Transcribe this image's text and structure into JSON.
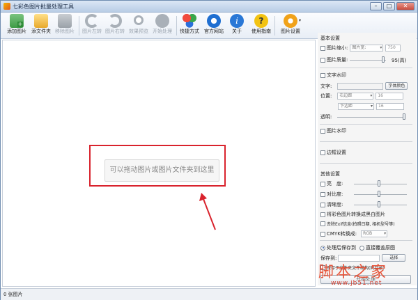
{
  "window": {
    "title": "七彩色图片批量处理工具"
  },
  "toolbar": {
    "add_image": "添加图片",
    "add_folder": "添文件夹",
    "remove_image": "移除图片",
    "rotate_left": "图片左转",
    "rotate_right": "图片右转",
    "preview": "效果预览",
    "start": "开始处理",
    "shortcut": "快捷方式",
    "website": "官方网站",
    "about": "关于",
    "guide": "使用指南",
    "settings": "图片设置"
  },
  "main": {
    "drop_hint": "可以拖动图片或图片文件夹到这里"
  },
  "side": {
    "basic": "基本设置",
    "shrink": "图片缩小:",
    "shrink_mode": "图片宽:",
    "shrink_value": "750",
    "quality": "图片质量:",
    "quality_value": "95(高)",
    "text_wm": "文字水印",
    "text_label": "文字:",
    "font_color_btn": "字体颜色",
    "position_label": "位置:",
    "pos_h": "右边距",
    "pos_h_val": "16",
    "pos_v": "下边距",
    "pos_v_val": "16",
    "opacity": "透明:",
    "image_wm": "图片水印",
    "border": "边框设置",
    "other": "其他设置",
    "brightness": "亮　度:",
    "contrast": "对比度:",
    "sharpness": "清晰度:",
    "grayscale": "将彩色图片转换成黑白图片",
    "exif": "去除Exif信息(拍照日期, 相机型号等)",
    "cmyk": "CMYK转换成:",
    "cmyk_value": "RGB",
    "save_after": "处理后保存到",
    "overwrite": "直接覆盖原图",
    "save_to": "保存到:",
    "choose_btn": "选择",
    "keep_structure": "保存子文件夹文件结构(同目录)",
    "start_btn": "开始处理"
  },
  "status": {
    "count": "0 张图片"
  },
  "watermark": {
    "logo": "脚本之家",
    "url": "www.jb51.net"
  }
}
